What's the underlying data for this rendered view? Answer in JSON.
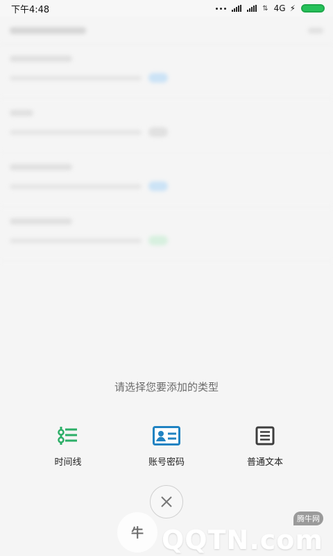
{
  "status_bar": {
    "time": "下午4:48",
    "network": "4G",
    "icons": [
      "signal-dots-icon",
      "cell-signal-icon",
      "cell-signal-icon",
      "data-arrows-icon",
      "charging-bolt-icon",
      "battery-icon"
    ]
  },
  "sheet": {
    "title": "请选择您要添加的类型",
    "options": [
      {
        "label": "时间线",
        "icon": "timeline-icon"
      },
      {
        "label": "账号密码",
        "icon": "account-card-icon"
      },
      {
        "label": "普通文本",
        "icon": "document-icon"
      }
    ]
  },
  "watermark": {
    "small_text": "腾牛网",
    "big_text": "QQTN.com"
  },
  "colors": {
    "accent_green": "#2cae67",
    "accent_blue": "#2083c2",
    "dark_icon": "#3e3e3e"
  }
}
